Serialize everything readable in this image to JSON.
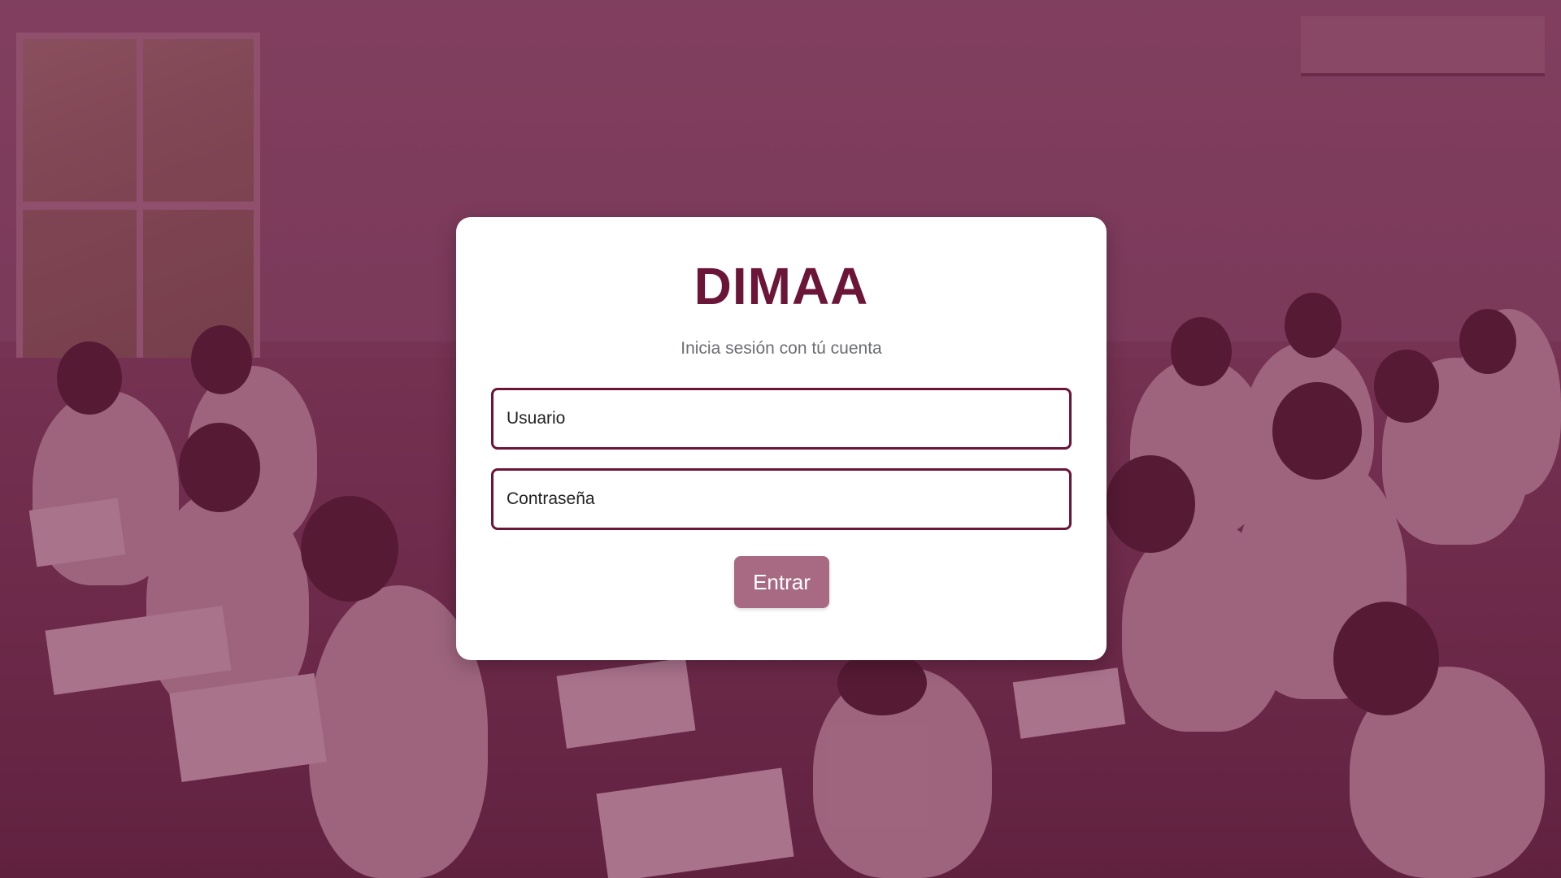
{
  "login": {
    "title": "DIMAA",
    "subtitle": "Inicia sesión con tú cuenta",
    "username_placeholder": "Usuario",
    "password_placeholder": "Contraseña",
    "submit_label": "Entrar"
  },
  "colors": {
    "brand": "#6b1538",
    "button": "#a86a83",
    "overlay": "#7a3a55",
    "card": "#ffffff",
    "subtitle_text": "#6c6c74"
  }
}
